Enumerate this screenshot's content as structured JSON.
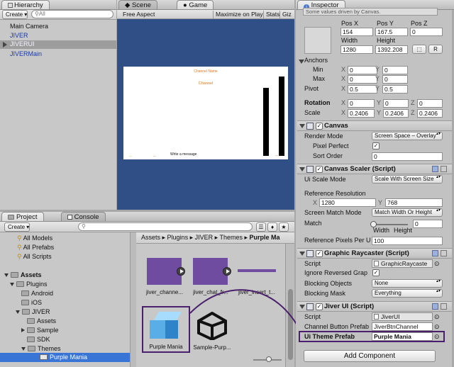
{
  "hierarchy": {
    "tab": "Hierarchy",
    "create_label": "Create",
    "search_placeholder": "All",
    "items": [
      "Main Camera",
      "JIVER",
      "JIVERUI",
      "JIVERMain"
    ]
  },
  "scene_tabs": {
    "scene": "Scene",
    "game": "Game"
  },
  "game_toolbar": {
    "aspect": "Free Aspect",
    "maximize": "Maximize on Play",
    "stats": "Stats",
    "gizmos": "Giz"
  },
  "game_view": {
    "title": "Channel Name",
    "subtitle": "Channel",
    "message": "Write a message",
    "foot_left": "—",
    "foot_mid": "—",
    "foot_right": "—"
  },
  "inspector": {
    "tab": "Inspector",
    "note": "Some values driven by Canvas.",
    "rect": {
      "posx_label": "Pos X",
      "posy_label": "Pos Y",
      "posz_label": "Pos Z",
      "posx": "154",
      "posy": "167.5",
      "posz": "0",
      "width_label": "Width",
      "height_label": "Height",
      "width": "1280",
      "height": "1392.208",
      "r_label": "R",
      "anchors": "Anchors",
      "min": "Min",
      "max": "Max",
      "pivot": "Pivot",
      "x": "X",
      "y": "Y",
      "z": "Z",
      "min_x": "0",
      "min_y": "0",
      "max_x": "0",
      "max_y": "0",
      "pivot_x": "0.5",
      "pivot_y": "0.5",
      "rotation": "Rotation",
      "rot_x": "0",
      "rot_y": "0",
      "rot_z": "0",
      "scale": "Scale",
      "scale_x": "0.2406",
      "scale_y": "0.2406",
      "scale_z": "0.2406"
    },
    "canvas": {
      "title": "Canvas",
      "render_mode_label": "Render Mode",
      "render_mode": "Screen Space – Overlay",
      "pixel_perfect_label": "Pixel Perfect",
      "sort_order_label": "Sort Order",
      "sort_order": "0"
    },
    "canvas_scaler": {
      "title": "Canvas Scaler (Script)",
      "ui_scale_mode_label": "Ui Scale Mode",
      "ui_scale_mode": "Scale With Screen Size",
      "ref_res_label": "Reference Resolution",
      "ref_x_label": "X",
      "ref_x": "1280",
      "ref_y_label": "Y",
      "ref_y": "768",
      "screen_match_label": "Screen Match Mode",
      "screen_match": "Match Width Or Height",
      "match_label": "Match",
      "match_value": "0",
      "width_label": "Width",
      "height_label": "Height",
      "ref_ppu_label": "Reference Pixels Per U",
      "ref_ppu": "100"
    },
    "graphic_raycaster": {
      "title": "Graphic Raycaster (Script)",
      "script_label": "Script",
      "script": "GraphicRaycaste",
      "ignore_reversed_label": "Ignore Reversed Grap",
      "blocking_objects_label": "Blocking Objects",
      "blocking_objects": "None",
      "blocking_mask_label": "Blocking Mask",
      "blocking_mask": "Everything"
    },
    "jiver_ui": {
      "title": "Jiver UI (Script)",
      "script_label": "Script",
      "script": "JiverUI",
      "channel_button_label": "Channel Button Prefab",
      "channel_button": "JiverBtnChannel",
      "theme_label": "Ui Theme Prefab",
      "theme": "Purple Mania"
    },
    "add_component": "Add Component"
  },
  "project": {
    "tab": "Project",
    "console_tab": "Console",
    "create_label": "Create",
    "favorites": [
      "All Models",
      "All Prefabs",
      "All Scripts"
    ],
    "tree": {
      "assets": "Assets",
      "plugins": "Plugins",
      "android": "Android",
      "ios": "iOS",
      "jiver": "JIVER",
      "jiver_assets": "Assets",
      "sample": "Sample",
      "sdk": "SDK",
      "themes": "Themes",
      "purple_mania": "Purple Mania"
    },
    "breadcrumb": [
      "Assets",
      "Plugins",
      "JIVER",
      "Themes",
      "Purple Ma"
    ],
    "files": [
      "jiver_channe...",
      "jiver_chat_fr...",
      "jiver_insert_t...",
      "Purple Mania",
      "Sample-Purp..."
    ]
  },
  "colors": {
    "accent_blue": "#3d6fd9",
    "game_bg": "#2f4f86",
    "thumb_purple": "#6f4ca0",
    "arrow_purple": "#4a1f6b",
    "selected_row": "#3875d7"
  }
}
